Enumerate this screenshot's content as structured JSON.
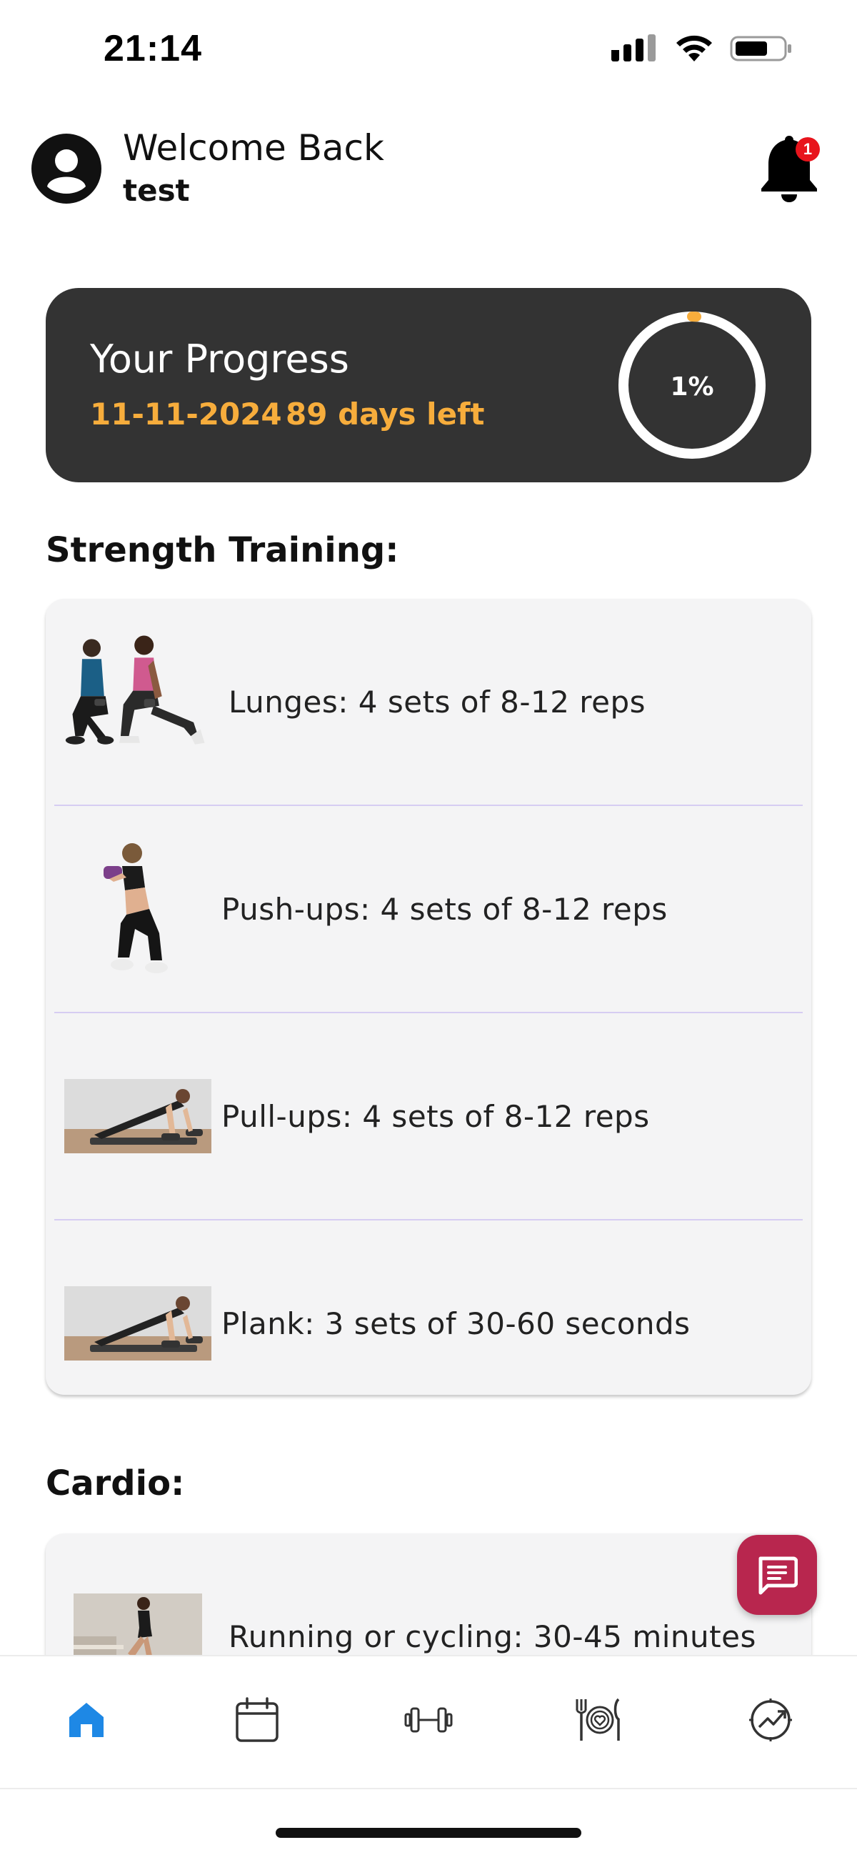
{
  "status_bar": {
    "time": "21:14",
    "icons": [
      "cellular-signal-icon",
      "wifi-icon",
      "battery-icon"
    ]
  },
  "header": {
    "welcome": "Welcome Back",
    "username": "test",
    "notification_count": "1"
  },
  "progress": {
    "title": "Your Progress",
    "date": "11-11-2024",
    "days_left": "89 days left",
    "percent_label": "1%",
    "percent_value": 0.01,
    "accent_color": "#f7ad3c"
  },
  "strength": {
    "heading": "Strength Training:",
    "items": [
      {
        "label": "Lunges: 4 sets of 8-12 reps",
        "image": "lunges-photo"
      },
      {
        "label": "Push-ups: 4 sets of 8-12 reps",
        "image": "squat-dumbbell-photo"
      },
      {
        "label": "Pull-ups: 4 sets of 8-12 reps",
        "image": "plank-row-photo"
      },
      {
        "label": "Plank: 3 sets of 30-60 seconds",
        "image": "plank-row-photo"
      }
    ]
  },
  "cardio": {
    "heading": "Cardio:",
    "items": [
      {
        "label": "Running or cycling: 30-45 minutes",
        "image": "running-stairs-photo"
      }
    ]
  },
  "nav": {
    "items": [
      "home-icon",
      "calendar-icon",
      "dumbbell-icon",
      "meal-icon",
      "progress-chart-icon"
    ],
    "active": "home-icon",
    "active_color": "#1e88e5"
  },
  "colors": {
    "card_dark": "#333333",
    "chat_button": "#b8264e",
    "badge": "#e8141c"
  }
}
